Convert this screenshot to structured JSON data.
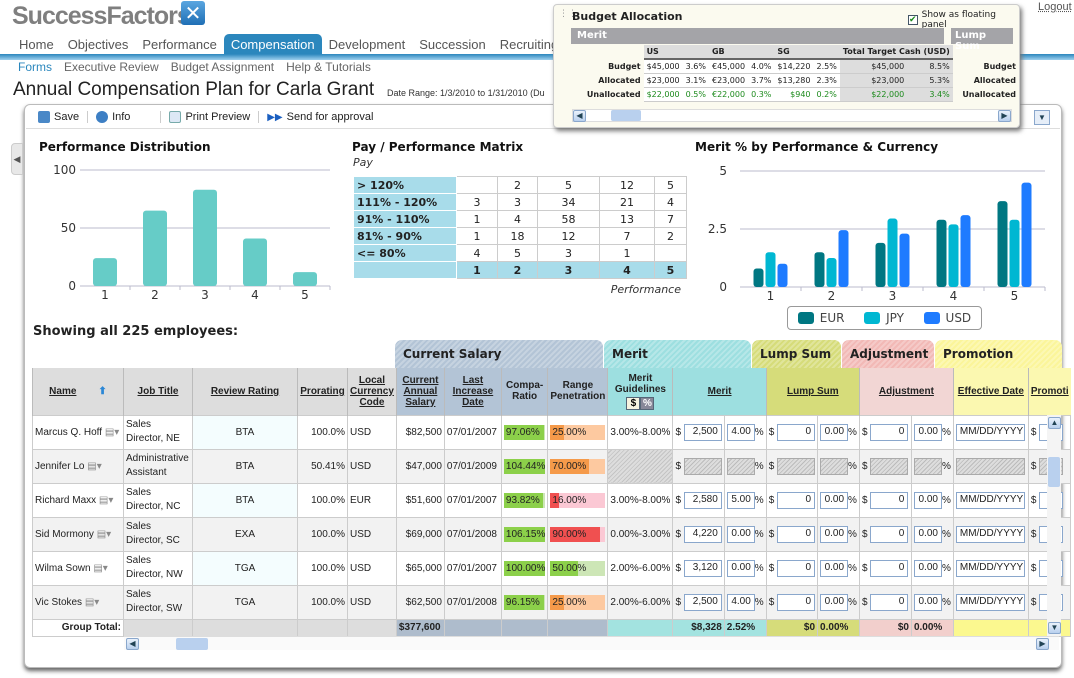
{
  "header": {
    "logo": "SuccessFactors",
    "logout": "Logout",
    "nav": [
      "Home",
      "Objectives",
      "Performance",
      "Compensation",
      "Development",
      "Succession",
      "Recruiting"
    ],
    "nav_active": 3,
    "subnav": [
      "Forms",
      "Executive Review",
      "Budget Assignment",
      "Help & Tutorials"
    ],
    "subnav_active": 0,
    "title": "Annual Compensation Plan for Carla Grant",
    "date_range": "Date Range: 1/3/2010 to 1/31/2010  (Du"
  },
  "toolbar": {
    "save": "Save",
    "info": "Info",
    "print_preview": "Print Preview",
    "send": "Send for approval"
  },
  "budget": {
    "title": "Budget Allocation",
    "floating_label": "Show as floating panel",
    "floating_checked": true,
    "merit": "Merit",
    "lump_sum": "Lump Sum",
    "cols": [
      "US",
      "GB",
      "SG",
      "Total Target Cash (USD)"
    ],
    "rows": [
      {
        "label": "Budget",
        "vals": [
          "$45,000",
          "3.6%",
          "€45,000",
          "4.0%",
          "$14,220",
          "2.5%",
          "$45,000",
          "8.5%"
        ],
        "lump_label": "Budget"
      },
      {
        "label": "Allocated",
        "vals": [
          "$23,000",
          "3.1%",
          "€23,000",
          "3.7%",
          "$13,280",
          "2.3%",
          "$23,000",
          "5.3%"
        ],
        "lump_label": "Allocated"
      },
      {
        "label": "Unallocated",
        "vals": [
          "$22,000",
          "0.5%",
          "€22,000",
          "0.3%",
          "$940",
          "0.2%",
          "$22,000",
          "3.4%"
        ],
        "lump_label": "Unallocated"
      }
    ]
  },
  "chart_data": [
    {
      "type": "bar",
      "title": "Performance Distribution",
      "categories": [
        "1",
        "2",
        "3",
        "4",
        "5"
      ],
      "values": [
        24,
        65,
        83,
        41,
        12
      ],
      "ylim": [
        0,
        100
      ],
      "yticks": [
        "0",
        "50",
        "100"
      ],
      "grid": true,
      "color": "#66ccc7"
    },
    {
      "type": "table",
      "title": "Pay / Performance Matrix",
      "ylabel": "Pay",
      "xlabel": "Performance",
      "row_labels": [
        "> 120%",
        "111% - 120%",
        "91% - 110%",
        "81% - 90%",
        "<= 80%"
      ],
      "col_labels": [
        "1",
        "2",
        "3",
        "4",
        "5"
      ],
      "cells": [
        [
          "",
          "2",
          "5",
          "12",
          "5"
        ],
        [
          "3",
          "3",
          "34",
          "21",
          "4"
        ],
        [
          "1",
          "4",
          "58",
          "13",
          "7"
        ],
        [
          "1",
          "18",
          "12",
          "7",
          "2"
        ],
        [
          "4",
          "5",
          "3",
          "1",
          ""
        ]
      ]
    },
    {
      "type": "bar",
      "title": "Merit % by Performance & Currency",
      "categories": [
        "1",
        "2",
        "3",
        "4",
        "5"
      ],
      "ylim": [
        0,
        5
      ],
      "yticks": [
        "0",
        "2.5",
        "5"
      ],
      "grid": true,
      "legend": "bottom",
      "series": [
        {
          "name": "EUR",
          "color": "#007782",
          "values": [
            0.8,
            1.5,
            1.9,
            2.9,
            3.7
          ]
        },
        {
          "name": "JPY",
          "color": "#00b7d2",
          "values": [
            1.5,
            1.25,
            2.95,
            2.7,
            2.9
          ]
        },
        {
          "name": "USD",
          "color": "#1e7bff",
          "values": [
            1.0,
            2.45,
            2.3,
            3.1,
            4.5
          ]
        }
      ]
    }
  ],
  "table": {
    "showing": "Showing all 225 employees:",
    "groups": {
      "current_salary": "Current Salary",
      "merit": "Merit",
      "lump_sum": "Lump Sum",
      "adjustment": "Adjustment",
      "promotion": "Promotion"
    },
    "headers": [
      "Name",
      "Job Title",
      "Review Rating",
      "Prorating",
      "Local Currency Code",
      "Current Annual Salary",
      "Last Increase Date",
      "Compa-Ratio",
      "Range Penetration",
      "Merit Guidelines",
      "Merit",
      "Lump Sum",
      "Adjustment",
      "Effective Date",
      "Promoti"
    ],
    "guideline_toggle": [
      "$",
      "%"
    ],
    "rows": [
      {
        "name": "Marcus Q. Hoff",
        "title": "Sales Director, NE",
        "rating": "BTA",
        "prorating": "100.0%",
        "currency": "USD",
        "salary": "$82,500",
        "last_increase": "07/01/2007",
        "compa": "97.06%",
        "range": "25.00%",
        "range_level": 25,
        "range_status": "orange",
        "guidelines": "3.00%-8.00%",
        "merit_amt": "2,500",
        "merit_pct": "4.00",
        "lump_amt": "0",
        "lump_pct": "0.00",
        "adj_amt": "0",
        "adj_pct": "0.00",
        "eff_date": "MM/DD/YYYY",
        "disabled": false
      },
      {
        "name": "Jennifer Lo",
        "title": "Administrative Assistant",
        "rating": "BTA",
        "prorating": "50.41%",
        "currency": "USD",
        "salary": "$47,000",
        "last_increase": "07/01/2009",
        "compa": "104.44%",
        "range": "70.00%",
        "range_level": 70,
        "range_status": "orange",
        "guidelines": "",
        "merit_amt": "",
        "merit_pct": "",
        "lump_amt": "",
        "lump_pct": "",
        "adj_amt": "",
        "adj_pct": "",
        "eff_date": "",
        "disabled": true
      },
      {
        "name": "Richard Maxx",
        "title": "Sales Director, NC",
        "rating": "BTA",
        "prorating": "100.0%",
        "currency": "EUR",
        "salary": "$51,600",
        "last_increase": "07/01/2007",
        "compa": "93.82%",
        "range": "16.00%",
        "range_level": 16,
        "range_status": "red",
        "guidelines": "3.00%-8.00%",
        "merit_amt": "2,580",
        "merit_pct": "5.00",
        "lump_amt": "0",
        "lump_pct": "0.00",
        "adj_amt": "0",
        "adj_pct": "0.00",
        "eff_date": "MM/DD/YYYY",
        "disabled": false
      },
      {
        "name": "Sid Mormony",
        "title": "Sales Director, SC",
        "rating": "EXA",
        "prorating": "100.0%",
        "currency": "USD",
        "salary": "$69,000",
        "last_increase": "07/01/2008",
        "compa": "106.15%",
        "range": "90.00%",
        "range_level": 90,
        "range_status": "red",
        "guidelines": "0.00%-3.00%",
        "merit_amt": "4,220",
        "merit_pct": "0.00",
        "lump_amt": "0",
        "lump_pct": "0.00",
        "adj_amt": "0",
        "adj_pct": "0.00",
        "eff_date": "MM/DD/YYYY",
        "disabled": false
      },
      {
        "name": "Wilma Sown",
        "title": "Sales Director, NW",
        "rating": "TGA",
        "prorating": "100.0%",
        "currency": "USD",
        "salary": "$65,000",
        "last_increase": "07/01/2007",
        "compa": "100.00%",
        "range": "50.00%",
        "range_level": 50,
        "range_status": "green",
        "guidelines": "2.00%-6.00%",
        "merit_amt": "3,120",
        "merit_pct": "0.00",
        "lump_amt": "0",
        "lump_pct": "0.00",
        "adj_amt": "0",
        "adj_pct": "0.00",
        "eff_date": "MM/DD/YYYY",
        "disabled": false
      },
      {
        "name": "Vic Stokes",
        "title": "Sales Director, SW",
        "rating": "TGA",
        "prorating": "100.0%",
        "currency": "USD",
        "salary": "$62,500",
        "last_increase": "07/01/2008",
        "compa": "96.15%",
        "range": "25.00%",
        "range_level": 25,
        "range_status": "orange",
        "guidelines": "2.00%-6.00%",
        "merit_amt": "2,500",
        "merit_pct": "4.00",
        "lump_amt": "0",
        "lump_pct": "0.00",
        "adj_amt": "0",
        "adj_pct": "0.00",
        "eff_date": "MM/DD/YYYY",
        "disabled": false
      }
    ],
    "total": {
      "label": "Group Total:",
      "salary": "$377,600",
      "merit_amt": "$8,328",
      "merit_pct": "2.52%",
      "lump_amt": "$0",
      "lump_pct": "0.00%",
      "adj_amt": "$0",
      "adj_pct": "0.00%"
    }
  }
}
